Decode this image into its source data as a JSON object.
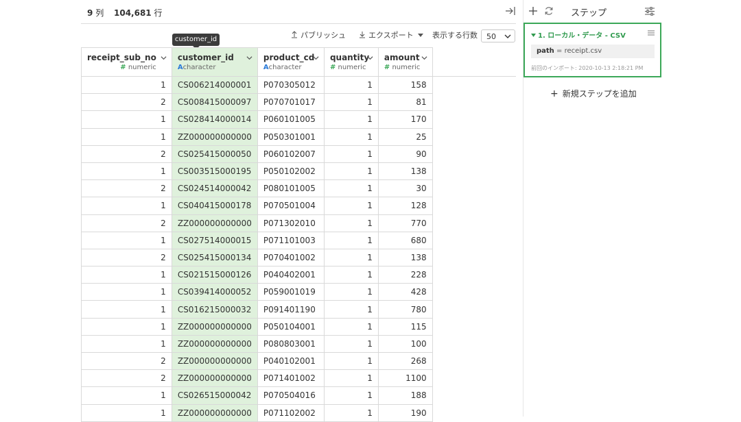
{
  "header": {
    "col_count": "9",
    "col_unit": "列",
    "row_count": "104,681",
    "row_unit": "行"
  },
  "tooltip": "customer_id",
  "toolbar": {
    "publish": "パブリッシュ",
    "export": "エクスポート",
    "rows_label": "表示する行数",
    "rows_value": "50"
  },
  "table": {
    "columns": [
      {
        "name": "receipt_sub_no",
        "sym": "#",
        "type": "numeric"
      },
      {
        "name": "customer_id",
        "sym": "A",
        "type": "character"
      },
      {
        "name": "product_cd",
        "sym": "A",
        "type": "character"
      },
      {
        "name": "quantity",
        "sym": "#",
        "type": "numeric"
      },
      {
        "name": "amount",
        "sym": "#",
        "type": "numeric"
      }
    ],
    "rows": [
      [
        "1",
        "CS006214000001",
        "P070305012",
        "1",
        "158"
      ],
      [
        "2",
        "CS008415000097",
        "P070701017",
        "1",
        "81"
      ],
      [
        "1",
        "CS028414000014",
        "P060101005",
        "1",
        "170"
      ],
      [
        "1",
        "ZZ000000000000",
        "P050301001",
        "1",
        "25"
      ],
      [
        "2",
        "CS025415000050",
        "P060102007",
        "1",
        "90"
      ],
      [
        "1",
        "CS003515000195",
        "P050102002",
        "1",
        "138"
      ],
      [
        "2",
        "CS024514000042",
        "P080101005",
        "1",
        "30"
      ],
      [
        "1",
        "CS040415000178",
        "P070501004",
        "1",
        "128"
      ],
      [
        "2",
        "ZZ000000000000",
        "P071302010",
        "1",
        "770"
      ],
      [
        "1",
        "CS027514000015",
        "P071101003",
        "1",
        "680"
      ],
      [
        "2",
        "CS025415000134",
        "P070401002",
        "1",
        "138"
      ],
      [
        "1",
        "CS021515000126",
        "P040402001",
        "1",
        "228"
      ],
      [
        "1",
        "CS039414000052",
        "P059001019",
        "1",
        "428"
      ],
      [
        "1",
        "CS016215000032",
        "P091401190",
        "1",
        "780"
      ],
      [
        "1",
        "ZZ000000000000",
        "P050104001",
        "1",
        "115"
      ],
      [
        "1",
        "ZZ000000000000",
        "P080803001",
        "1",
        "100"
      ],
      [
        "2",
        "ZZ000000000000",
        "P040102001",
        "1",
        "268"
      ],
      [
        "2",
        "ZZ000000000000",
        "P071401002",
        "1",
        "1100"
      ],
      [
        "1",
        "CS026515000042",
        "P070504016",
        "1",
        "188"
      ],
      [
        "1",
        "ZZ000000000000",
        "P071102002",
        "1",
        "190"
      ]
    ]
  },
  "sidebar": {
    "title": "ステップ",
    "step": {
      "title": "1. ローカル・データ - CSV",
      "path_key": "path",
      "path_eq": " = ",
      "path_value": "receipt.csv",
      "last_import": "前回のインポート: 2020-10-13 2:18:21 PM"
    },
    "add_step": "新規ステップを追加"
  },
  "colors": {
    "accent": "#3aa757",
    "selected_col": "#dff1dc",
    "char_icon": "#2a7ad8"
  }
}
